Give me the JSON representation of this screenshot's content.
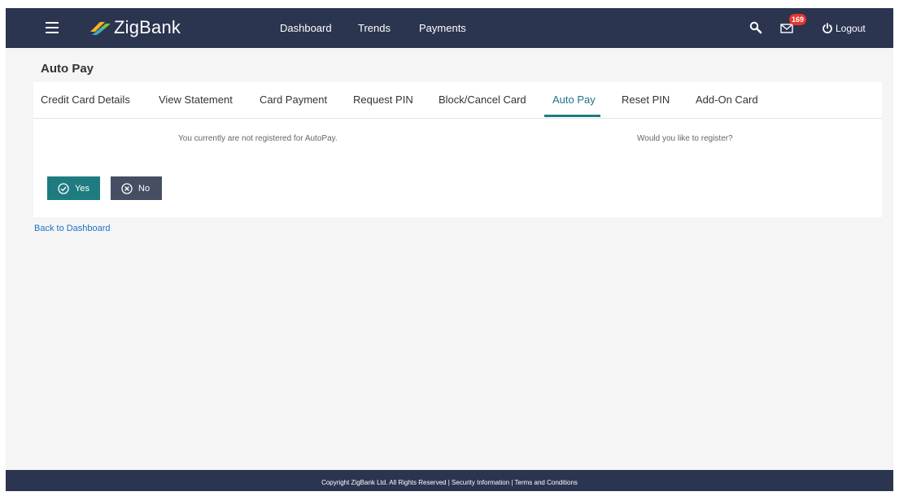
{
  "header": {
    "logo_text": "ZigBank",
    "nav": [
      "Dashboard",
      "Trends",
      "Payments"
    ],
    "notification_count": "169",
    "logout_label": "Logout"
  },
  "page": {
    "title": "Auto Pay"
  },
  "tabs": [
    {
      "label": "Credit Card Details",
      "active": false
    },
    {
      "label": "View Statement",
      "active": false
    },
    {
      "label": "Card Payment",
      "active": false
    },
    {
      "label": "Request PIN",
      "active": false
    },
    {
      "label": "Block/Cancel Card",
      "active": false
    },
    {
      "label": "Auto Pay",
      "active": true
    },
    {
      "label": "Reset PIN",
      "active": false
    },
    {
      "label": "Add-On Card",
      "active": false
    }
  ],
  "content": {
    "status_message": "You currently are not registered for AutoPay.",
    "question": "Would you like to register?",
    "yes_label": "Yes",
    "no_label": "No"
  },
  "back_link": "Back to Dashboard",
  "footer": {
    "text": "Copyright ZigBank Ltd. All Rights Reserved | Security Information | Terms and Conditions"
  },
  "colors": {
    "header_bg": "#2b3550",
    "accent_teal": "#1e7c80",
    "no_button": "#464e63",
    "badge_red": "#e8352d",
    "link_blue": "#1a73c9"
  },
  "icons": [
    "hamburger-icon",
    "zigbank-logo-icon",
    "search-icon",
    "mail-icon",
    "power-icon",
    "check-circle-icon",
    "x-circle-icon"
  ]
}
